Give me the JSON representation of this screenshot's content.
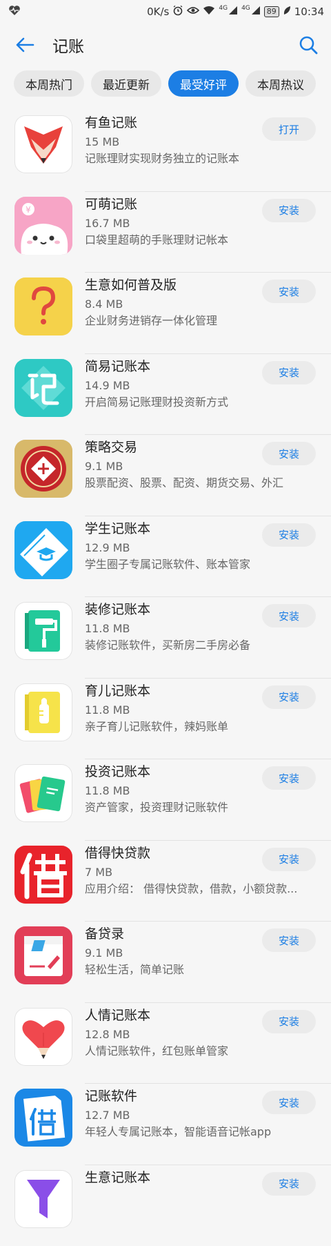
{
  "status_bar": {
    "speed": "0K/s",
    "net1": "4G",
    "net2": "4G",
    "battery": "89",
    "time": "10:34",
    "icons": [
      "heart-monitor-icon",
      "alarm-icon",
      "eye-icon",
      "wifi-icon",
      "signal-icon",
      "battery-icon",
      "leaf-icon"
    ]
  },
  "header": {
    "title": "记账",
    "back_icon": "back-arrow-icon",
    "search_icon": "search-icon"
  },
  "tabs": [
    {
      "label": "本周热门",
      "active": false
    },
    {
      "label": "最近更新",
      "active": false
    },
    {
      "label": "最受好评",
      "active": true
    },
    {
      "label": "本周热议",
      "active": false
    }
  ],
  "colors": {
    "accent": "#1c7ee4",
    "background": "#f6f6f6"
  },
  "apps": [
    {
      "name": "有鱼记账",
      "size": "15 MB",
      "desc": "记账理财实现财务独立的记账本",
      "action": "打开",
      "icon": "fox-icon"
    },
    {
      "name": "可萌记账",
      "size": "16.7 MB",
      "desc": "口袋里超萌的手账理财记帐本",
      "action": "安装",
      "icon": "cute-cat-icon"
    },
    {
      "name": "生意如何普及版",
      "size": "8.4 MB",
      "desc": "企业财务进销存一体化管理",
      "action": "安装",
      "icon": "question-mark-icon"
    },
    {
      "name": "简易记账本",
      "size": "14.9 MB",
      "desc": "开启简易记账理财投资新方式",
      "action": "安装",
      "icon": "ji-character-icon"
    },
    {
      "name": "策略交易",
      "size": "9.1 MB",
      "desc": "股票配资、股票、配资、期货交易、外汇",
      "action": "安装",
      "icon": "red-coin-icon"
    },
    {
      "name": "学生记账本",
      "size": "12.9 MB",
      "desc": "学生圈子专属记账软件、账本管家",
      "action": "安装",
      "icon": "graduation-cap-icon"
    },
    {
      "name": "装修记账本",
      "size": "11.8 MB",
      "desc": "装修记账软件，买新房二手房必备",
      "action": "安装",
      "icon": "paint-roller-icon"
    },
    {
      "name": "育儿记账本",
      "size": "11.8 MB",
      "desc": "亲子育儿记账软件，辣妈账单",
      "action": "安装",
      "icon": "baby-bottle-icon"
    },
    {
      "name": "投资记账本",
      "size": "11.8 MB",
      "desc": "资产管家，投资理财记账软件",
      "action": "安装",
      "icon": "notebooks-icon"
    },
    {
      "name": "借得快贷款",
      "size": "7 MB",
      "desc": "应用介绍： 借得快贷款，借款，小额贷款...",
      "action": "安装",
      "icon": "jie-character-icon"
    },
    {
      "name": "备贷录",
      "size": "9.1 MB",
      "desc": "轻松生活，简单记账",
      "action": "安装",
      "icon": "notebook-pen-icon"
    },
    {
      "name": "人情记账本",
      "size": "12.8 MB",
      "desc": "人情记账软件，红包账单管家",
      "action": "安装",
      "icon": "heart-pencil-icon"
    },
    {
      "name": "记账软件",
      "size": "12.7 MB",
      "desc": "年轻人专属记账本，智能语音记帐app",
      "action": "安装",
      "icon": "jie-book-icon"
    },
    {
      "name": "生意记账本",
      "size": "",
      "desc": "",
      "action": "安装",
      "icon": "funnel-icon"
    }
  ]
}
